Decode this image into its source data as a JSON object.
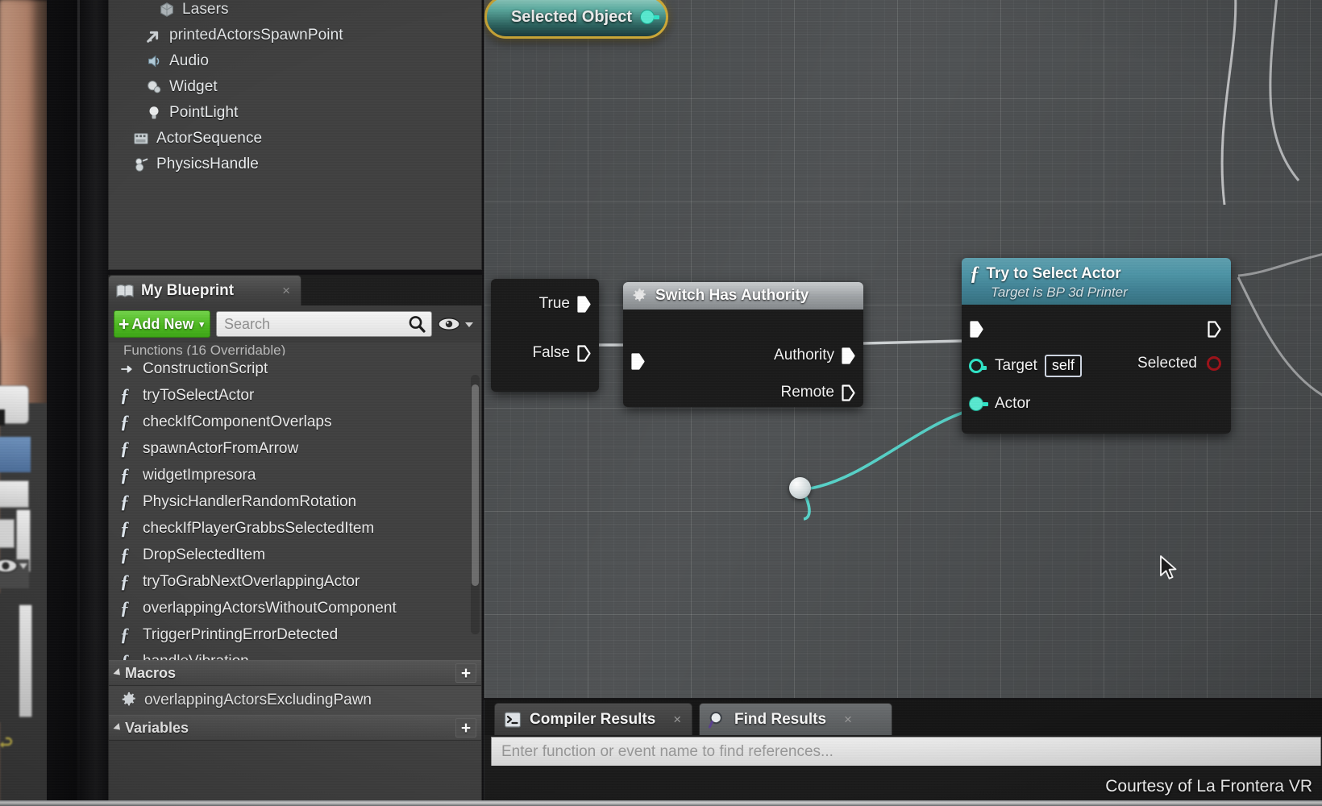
{
  "components_tree": {
    "items": [
      {
        "label": "Lasers",
        "icon": "mesh-icon",
        "indent": 2
      },
      {
        "label": "printedActorsSpawnPoint",
        "icon": "arrow-icon",
        "indent": 1
      },
      {
        "label": "Audio",
        "icon": "audio-icon",
        "indent": 1
      },
      {
        "label": "Widget",
        "icon": "widget-icon",
        "indent": 1
      },
      {
        "label": "PointLight",
        "icon": "pointlight-icon",
        "indent": 1
      },
      {
        "label": "ActorSequence",
        "icon": "sequence-icon",
        "indent": 0
      },
      {
        "label": "PhysicsHandle",
        "icon": "physicshandle-icon",
        "indent": 0
      }
    ]
  },
  "my_blueprint": {
    "tab_label": "My Blueprint",
    "tab_icon": "blueprint-icon",
    "close_label": "×",
    "add_new_label": "Add New",
    "add_new_plus": "+",
    "add_new_caret": "▾",
    "search_placeholder": "Search",
    "search_value": "",
    "search_icon": "search-icon",
    "eye_icon": "eye-icon",
    "eye_caret": "▾",
    "partial_header_text": "Functions (16 Overridable)",
    "functions": [
      {
        "label": "ConstructionScript",
        "icon": "construction-script-icon"
      },
      {
        "label": "tryToSelectActor",
        "icon": "function-icon"
      },
      {
        "label": "checkIfComponentOverlaps",
        "icon": "function-icon"
      },
      {
        "label": "spawnActorFromArrow",
        "icon": "function-icon"
      },
      {
        "label": "widgetImpresora",
        "icon": "function-icon"
      },
      {
        "label": "PhysicHandlerRandomRotation",
        "icon": "function-icon"
      },
      {
        "label": "checkIfPlayerGrabbsSelectedItem",
        "icon": "function-icon"
      },
      {
        "label": "DropSelectedItem",
        "icon": "function-icon"
      },
      {
        "label": "tryToGrabNextOverlappingActor",
        "icon": "function-icon"
      },
      {
        "label": "overlappingActorsWithoutComponent",
        "icon": "function-icon"
      },
      {
        "label": "TriggerPrintingErrorDetected",
        "icon": "function-icon"
      },
      {
        "label": "handleVibration",
        "icon": "function-icon"
      }
    ],
    "macros_section": {
      "label": "Macros",
      "add_label": "+",
      "items": [
        {
          "label": "overlappingActorsExcludingPawn",
          "icon": "macro-icon"
        }
      ]
    },
    "variables_section": {
      "label": "Variables",
      "add_label": "+"
    }
  },
  "graph": {
    "branch_node": {
      "true_label": "True",
      "false_label": "False",
      "true_pin_filled": true,
      "false_pin_filled": false
    },
    "authority_node": {
      "title": "Switch Has Authority",
      "icon": "gear-icon",
      "exec_in_filled": true,
      "outputs": [
        {
          "label": "Authority",
          "filled": true
        },
        {
          "label": "Remote",
          "filled": false
        }
      ]
    },
    "try_select_actor_node": {
      "title": "Try to Select Actor",
      "subtitle": "Target is BP 3d Printer",
      "icon": "function-icon",
      "exec_in_filled": true,
      "exec_out_filled": false,
      "inputs": [
        {
          "label": "Target",
          "value": "self",
          "pin": "object-ref-hollow"
        },
        {
          "label": "Actor",
          "value": "",
          "pin": "object-ref-filled"
        }
      ],
      "outputs": [
        {
          "label": "Selected",
          "pin": "boolean-hollow"
        }
      ],
      "header_color": "#4d94a6"
    },
    "selected_object_node": {
      "label": "Selected Object",
      "pin": "object-ref-filled",
      "selected": true,
      "selection_color": "#d8b23a"
    },
    "wire_color": "#5ad9cf",
    "exec_wire_color": "#d4d8da"
  },
  "bottom_dock": {
    "tabs": [
      {
        "label": "Compiler Results",
        "icon": "console-icon",
        "active": false,
        "close_label": "×"
      },
      {
        "label": "Find Results",
        "icon": "search-icon",
        "active": true,
        "close_label": "×"
      }
    ],
    "find_search_placeholder": "Enter function or event name to find references...",
    "find_search_value": ""
  },
  "watermark": {
    "text": "Courtesy of La Frontera VR"
  }
}
